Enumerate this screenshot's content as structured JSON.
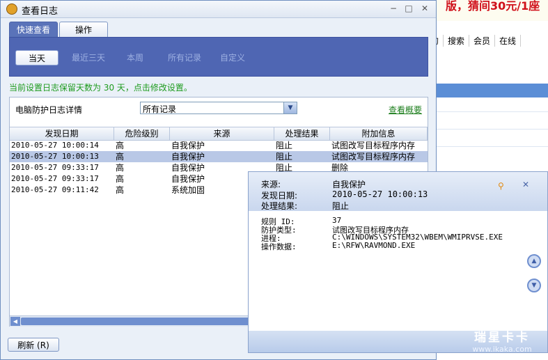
{
  "background_page": {
    "banner": "版，猜间30元/1座",
    "nav": [
      "我的",
      "搜索",
      "会员",
      "在线"
    ]
  },
  "window": {
    "title": "查看日志",
    "min_glyph": "−",
    "max_glyph": "□",
    "close_glyph": "✕"
  },
  "tabs": [
    {
      "label": "快速查看",
      "active": true
    },
    {
      "label": "操作",
      "active": false
    }
  ],
  "filters": [
    {
      "label": "当天",
      "active": true
    },
    {
      "label": "最近三天",
      "active": false
    },
    {
      "label": "本周",
      "active": false
    },
    {
      "label": "所有记录",
      "active": false
    },
    {
      "label": "自定义",
      "active": false
    }
  ],
  "notice": "当前设置日志保留天数为 30 天，点击修改设置。",
  "content": {
    "detail_label": "电脑防护日志详情",
    "select_value": "所有记录",
    "overview_link": "查看概要",
    "columns": [
      "发现日期",
      "危险级别",
      "来源",
      "处理结果",
      "附加信息"
    ],
    "rows": [
      {
        "date": "2010-05-27 10:00:14",
        "level": "高",
        "source": "自我保护",
        "result": "阻止",
        "info": "试图改写目标程序内存",
        "selected": false
      },
      {
        "date": "2010-05-27 10:00:13",
        "level": "高",
        "source": "自我保护",
        "result": "阻止",
        "info": "试图改写目标程序内存",
        "selected": true
      },
      {
        "date": "2010-05-27 09:33:17",
        "level": "高",
        "source": "自我保护",
        "result": "阻止",
        "info": "删除",
        "selected": false
      },
      {
        "date": "2010-05-27 09:33:17",
        "level": "高",
        "source": "自我保护",
        "result": "",
        "info": "",
        "selected": false
      },
      {
        "date": "2010-05-27 09:11:42",
        "level": "高",
        "source": "系统加固",
        "result": "",
        "info": "",
        "selected": false
      }
    ]
  },
  "refresh_button": "刷新 (R)",
  "popup": {
    "source_key": "来源:",
    "source_val": "自我保护",
    "date_key": "发现日期:",
    "date_val": "2010-05-27 10:00:13",
    "result_key": "处理结果:",
    "result_val": "阻止",
    "rule_key": "规则 ID:",
    "rule_val": "37",
    "type_key": "防护类型:",
    "type_val": "试图改写目标程序内存",
    "process_key": "进程:",
    "process_val": "C:\\WINDOWS\\SYSTEM32\\WBEM\\WMIPRVSE.EXE",
    "op_key": "操作数据:",
    "op_val": "E:\\RFW\\RAVMOND.EXE",
    "pin_glyph": "⚲",
    "close_glyph": "✕",
    "up_glyph": "▲",
    "down_glyph": "▼"
  },
  "watermark": {
    "line1": "瑞星卡卡",
    "line2": "www.ikaka.com"
  }
}
